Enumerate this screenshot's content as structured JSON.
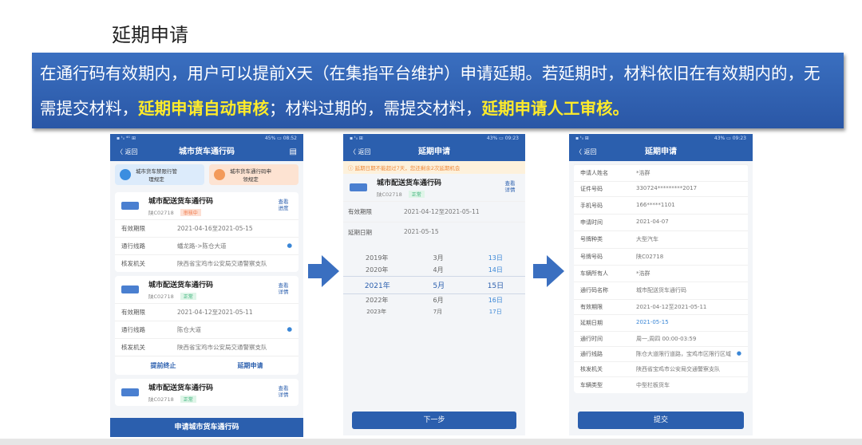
{
  "title": "延期申请",
  "banner": {
    "p1": "在通行码有效期内，用户可以提前X天（在集指平台维护）申请延期。若延期时，材料依旧在有效期内的，无需提交材料，",
    "h1": "延期申请自动审核",
    "p2": "；材料过期的，需提交材料，",
    "h2": "延期申请人工审核。"
  },
  "phone1": {
    "status_left": "▪ ᵗᵢₗ ⁴ᴳ ⊞",
    "status_right": "45% ▭ 08:52",
    "back": "〈 返回",
    "title": "城市货车通行码",
    "shortcuts": [
      "城市货车禁限行管理规定",
      "城市货车通行码申领规定"
    ],
    "cards": [
      {
        "name": "城市配送货车通行码",
        "plate": "陕C02718",
        "tag": "审核中",
        "detail": "查看进度",
        "rows": [
          [
            "有效期限",
            "2021-04-16至2021-05-15"
          ],
          [
            "通行线路",
            "蟠龙路->陈仓大道"
          ],
          [
            "核发机关",
            "陕西省宝鸡市公安局交通警察支队"
          ]
        ]
      },
      {
        "name": "城市配送货车通行码",
        "plate": "陕C02718",
        "tag": "正常",
        "detail": "查看详情",
        "rows": [
          [
            "有效期限",
            "2021-04-12至2021-05-11"
          ],
          [
            "通行线路",
            "陈仓大道"
          ],
          [
            "核发机关",
            "陕西省宝鸡市公安局交通警察支队"
          ]
        ],
        "actions": [
          "提前终止",
          "延期申请"
        ]
      },
      {
        "name": "城市配送货车通行码",
        "plate": "陕C02718",
        "tag": "正常",
        "detail": "查看详情"
      }
    ],
    "button": "申请城市货车通行码"
  },
  "phone2": {
    "status_left": "▪ ᵗᵢₗ ⊞",
    "status_right": "43% ▭ 09:23",
    "back": "〈 返回",
    "title": "延期申请",
    "notice": "延期日期不能超过7天，您还剩余2次延期机会",
    "card": {
      "name": "城市配送货车通行码",
      "plate": "陕C02718",
      "tag": "正常",
      "detail": "查看详情"
    },
    "rows": [
      [
        "有效期限",
        "2021-04-12至2021-05-11"
      ],
      [
        "延期日期",
        "2021-05-15"
      ]
    ],
    "picker": [
      [
        "2019年",
        "3月",
        "13日"
      ],
      [
        "2020年",
        "4月",
        "14日"
      ],
      [
        "2021年",
        "5月",
        "15日"
      ],
      [
        "2022年",
        "6月",
        "16日"
      ],
      [
        "2023年",
        "7月",
        "17日"
      ]
    ],
    "button": "下一步"
  },
  "phone3": {
    "status_left": "▪ ᵗᵢₗ ⊞",
    "status_right": "43% ▭ 09:23",
    "back": "〈 返回",
    "title": "延期申请",
    "rows": [
      [
        "申请人姓名",
        "*浩群"
      ],
      [
        "证件号码",
        "330724*********2017"
      ],
      [
        "手机号码",
        "166*****1101"
      ],
      [
        "申请时间",
        "2021-04-07"
      ],
      [
        "号牌种类",
        "大型汽车"
      ],
      [
        "号牌号码",
        "陕C02718"
      ],
      [
        "车辆所有人",
        "*浩群"
      ],
      [
        "通行码名称",
        "城市配送货车通行码"
      ],
      [
        "有效期限",
        "2021-04-12至2021-05-11"
      ],
      [
        "延期日期",
        "2021-05-15"
      ],
      [
        "通行时间",
        "周一,周四 00:00-03:59"
      ],
      [
        "通行线路",
        "陈仓大道限行道路，宝鸡市区限行区域"
      ],
      [
        "核发机关",
        "陕西省宝鸡市公安局交通警察支队"
      ],
      [
        "车辆类型",
        "中型栏板货车"
      ]
    ],
    "button": "提交"
  },
  "colors": {
    "primary": "#2b5fae",
    "highlight": "#ffeb2a"
  }
}
